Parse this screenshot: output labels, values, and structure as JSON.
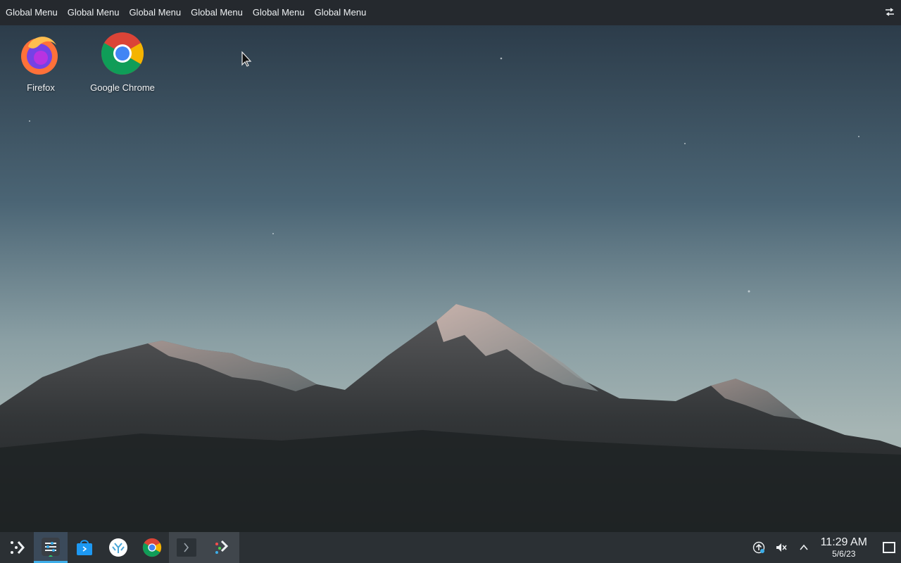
{
  "topbar": {
    "menus": [
      "Global Menu",
      "Global Menu",
      "Global Menu",
      "Global Menu",
      "Global Menu",
      "Global Menu"
    ]
  },
  "desktop": {
    "icons": [
      {
        "label": "Firefox",
        "icon": "firefox-icon"
      },
      {
        "label": "Google Chrome",
        "icon": "chrome-icon"
      }
    ]
  },
  "taskbar": {
    "launcher_icon": "app-launcher-icon",
    "apps": [
      {
        "icon": "system-settings-icon",
        "state": "active"
      },
      {
        "icon": "discover-store-icon",
        "state": "normal"
      },
      {
        "icon": "coral-app-icon",
        "state": "normal"
      },
      {
        "icon": "chrome-icon",
        "state": "normal"
      },
      {
        "icon": "terminal-icon",
        "state": "open"
      },
      {
        "icon": "steam-deck-icon",
        "state": "open"
      }
    ],
    "tray": {
      "time": "11:29 AM",
      "date": "5/6/23"
    }
  },
  "colors": {
    "topbar_bg": "#25292e",
    "taskbar_bg": "#2b3034",
    "accent": "#3daee9"
  }
}
